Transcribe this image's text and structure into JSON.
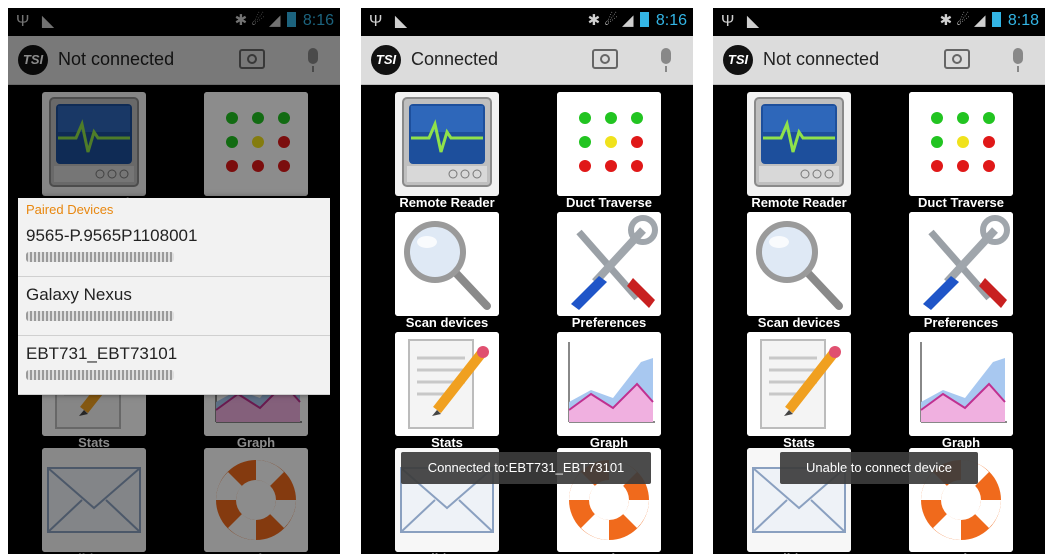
{
  "screens": [
    {
      "status": {
        "icons_left": [
          "Ψ",
          "◣"
        ],
        "icons_right": "✱ ☄ ◢",
        "time": "8:16"
      },
      "title": "Not connected",
      "dialog": {
        "title": "Paired Devices",
        "devices": [
          {
            "name": "9565-P.9565P1108001"
          },
          {
            "name": "Galaxy Nexus"
          },
          {
            "name": "EBT731_EBT73101"
          }
        ]
      }
    },
    {
      "status": {
        "icons_left": [
          "Ψ",
          "◣"
        ],
        "icons_right": "✱ ☄ ◢",
        "time": "8:16"
      },
      "title": "Connected",
      "toast": "Connected to:EBT731_EBT73101"
    },
    {
      "status": {
        "icons_left": [
          "Ψ",
          "◣"
        ],
        "icons_right": "✱ ☄ ◢",
        "time": "8:18"
      },
      "title": "Not connected",
      "toast": "Unable to connect device"
    }
  ],
  "logo": "TSI",
  "tiles": [
    {
      "label": "Remote Reader",
      "icon": "monitor-icon"
    },
    {
      "label": "Duct Traverse",
      "icon": "dots-grid-icon"
    },
    {
      "label": "Scan devices",
      "icon": "magnifier-icon"
    },
    {
      "label": "Preferences",
      "icon": "tools-icon"
    },
    {
      "label": "Stats",
      "icon": "notepad-pencil-icon"
    },
    {
      "label": "Graph",
      "icon": "area-graph-icon"
    },
    {
      "label": "Email / Export",
      "icon": "envelope-icon"
    },
    {
      "label": "Help",
      "icon": "lifebuoy-icon"
    }
  ],
  "colors": {
    "accent": "#33b5e5",
    "dialog_title": "#e8870f"
  }
}
